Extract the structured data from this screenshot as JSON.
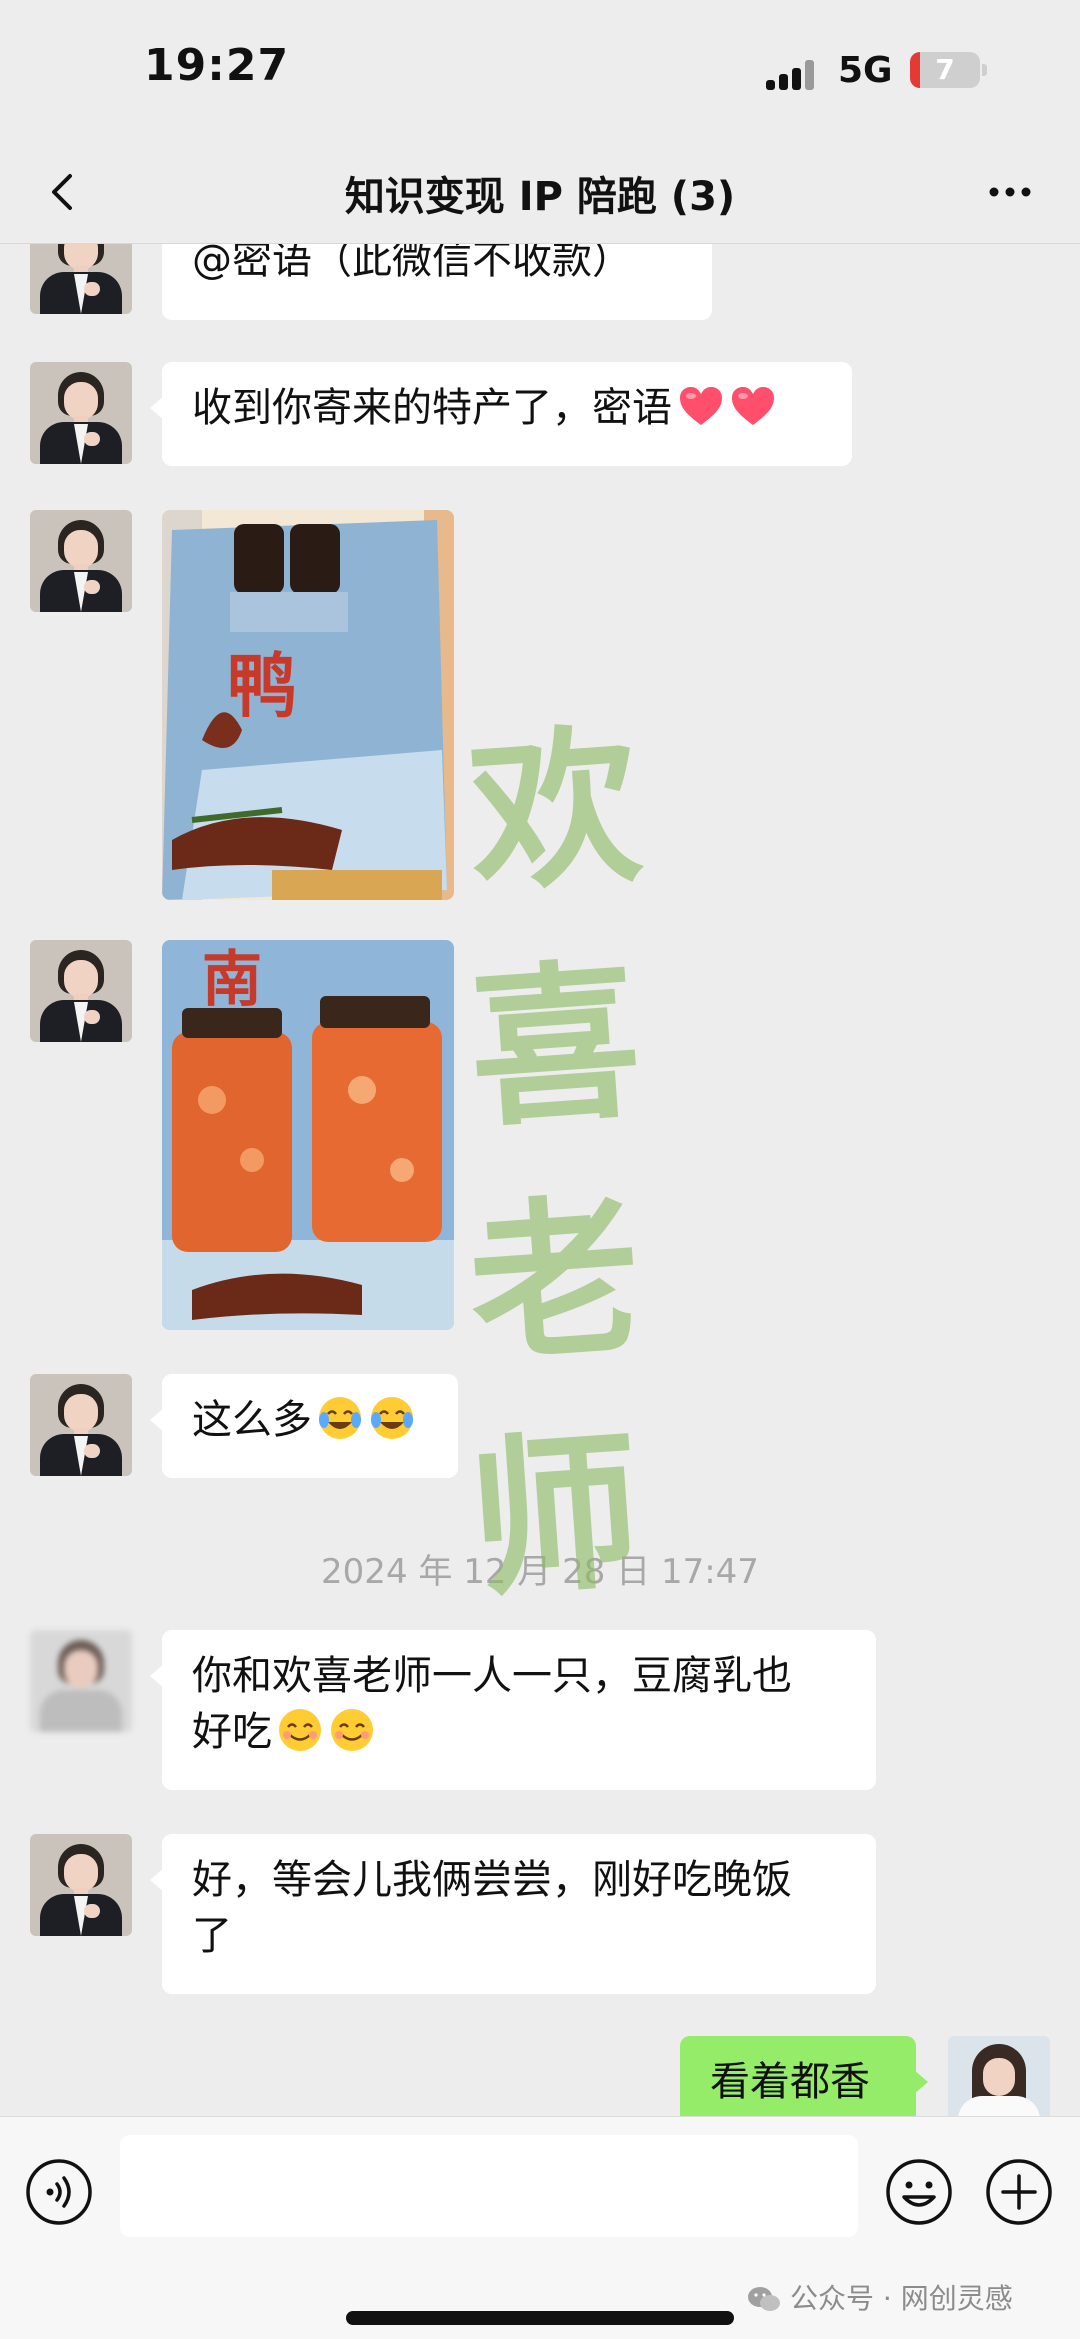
{
  "status_bar": {
    "time": "19:27",
    "network": "5G",
    "battery": "7",
    "battery_level": 7
  },
  "header": {
    "title": "知识变现 IP 陪跑 (3)"
  },
  "messages": [
    {
      "text": "@密语（此微信不收款）"
    },
    {
      "text": "收到你寄来的特产了，密语"
    },
    {
      "text": "这么多"
    },
    {
      "text_line1": "你和欢喜老师一人一只，豆腐乳也",
      "text_line2": "好吃"
    },
    {
      "text_line1": "好，等会儿我俩尝尝，刚好吃晚饭",
      "text_line2": "了"
    },
    {
      "text": "看着都香"
    }
  ],
  "timestamp": "2024 年 12 月 28 日 17:47",
  "watermark_chars": [
    "欢",
    "喜",
    "老",
    "师"
  ],
  "footer": {
    "source": "公众号 · 网创灵感"
  },
  "colors": {
    "background": "#ededed",
    "bubble_other": "#ffffff",
    "bubble_self": "#95ec69",
    "timestamp": "#a8a8a8",
    "watermark": "#8cb964",
    "heart": "#ff4f6d"
  },
  "icons": [
    "back-icon",
    "more-icon",
    "heart-emoji",
    "tears-of-joy-emoji",
    "smiling-face-emoji",
    "voice-icon",
    "emoji-icon",
    "plus-icon",
    "wechat-icon"
  ]
}
